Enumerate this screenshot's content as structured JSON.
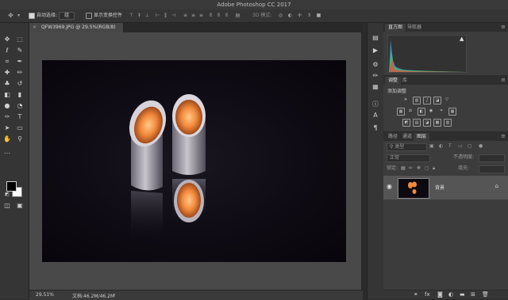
{
  "app": {
    "title": "Adobe Photoshop CC 2017"
  },
  "options": {
    "auto_select_label": "自动选择:",
    "auto_select_target": "组",
    "show_transform_label": "显示变换控件",
    "mode_3d_label": "3D 模式:"
  },
  "document": {
    "tab_title": "QFW3969.JPG @ 29.5%(RGB/8)"
  },
  "status": {
    "zoom": "29.51%",
    "doc_info": "文档:46.2M/46.2M"
  },
  "panels": {
    "histogram": {
      "tabs": [
        "直方图",
        "导航器"
      ]
    },
    "adjustments": {
      "tabs": [
        "调整",
        "库"
      ],
      "add_label": "添加调整"
    },
    "layers": {
      "tabs": [
        "路径",
        "通道",
        "图层"
      ],
      "filter_placeholder": "类型",
      "blend_mode": "正常",
      "opacity_label": "不透明度:",
      "lock_label": "锁定:",
      "fill_label": "填充:",
      "layer_name": "背景"
    }
  },
  "colors": {
    "foreground": "#000000",
    "background": "#ffffff",
    "accent": "#f28a3c"
  },
  "icons": [
    "move-tool-icon",
    "marquee-icon",
    "lasso-icon",
    "crop-icon",
    "eyedropper-icon",
    "brush-icon",
    "stamp-icon",
    "eraser-icon",
    "gradient-icon",
    "dodge-icon",
    "pen-icon",
    "type-icon",
    "path-select-icon",
    "shape-icon",
    "hand-icon",
    "zoom-icon",
    "eye-icon",
    "lock-icon"
  ]
}
